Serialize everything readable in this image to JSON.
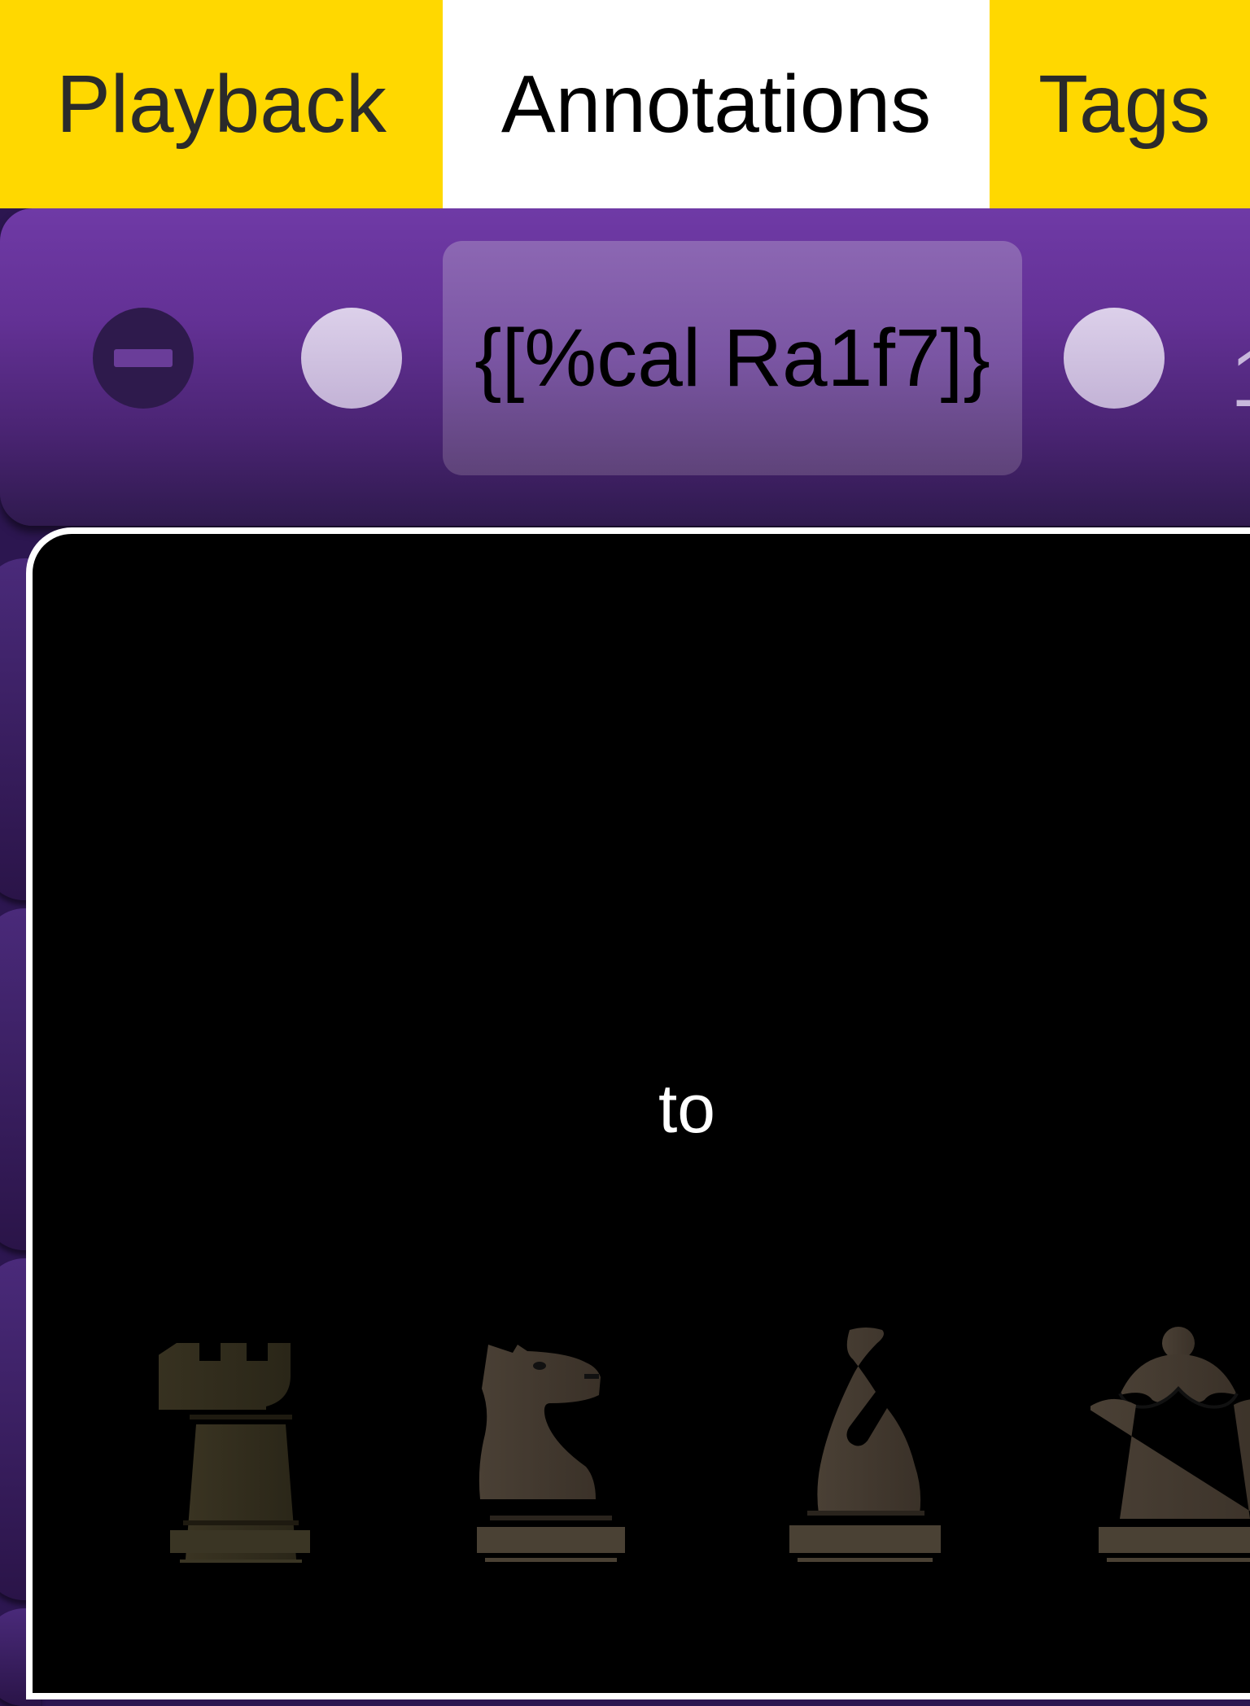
{
  "tabs": [
    {
      "label": "Playback",
      "active": false
    },
    {
      "label": "Annotations",
      "active": true
    },
    {
      "label": "Tags",
      "active": false
    }
  ],
  "colors": {
    "tab_background": "#ffd800",
    "tab_active_background": "#ffffff",
    "row_purple": "#6f3aa6",
    "panel_background": "#000000"
  },
  "annotation_row": {
    "remove_icon": "minus-circle-icon",
    "annotation_text": "{[%cal Ra1f7]}",
    "trailing_text": "1"
  },
  "promotion_panel": {
    "label": "to",
    "pieces": [
      {
        "name": "rook",
        "icon": "black-rook-icon"
      },
      {
        "name": "knight",
        "icon": "black-knight-icon"
      },
      {
        "name": "bishop",
        "icon": "black-bishop-icon"
      },
      {
        "name": "queen",
        "icon": "black-queen-icon"
      }
    ]
  }
}
